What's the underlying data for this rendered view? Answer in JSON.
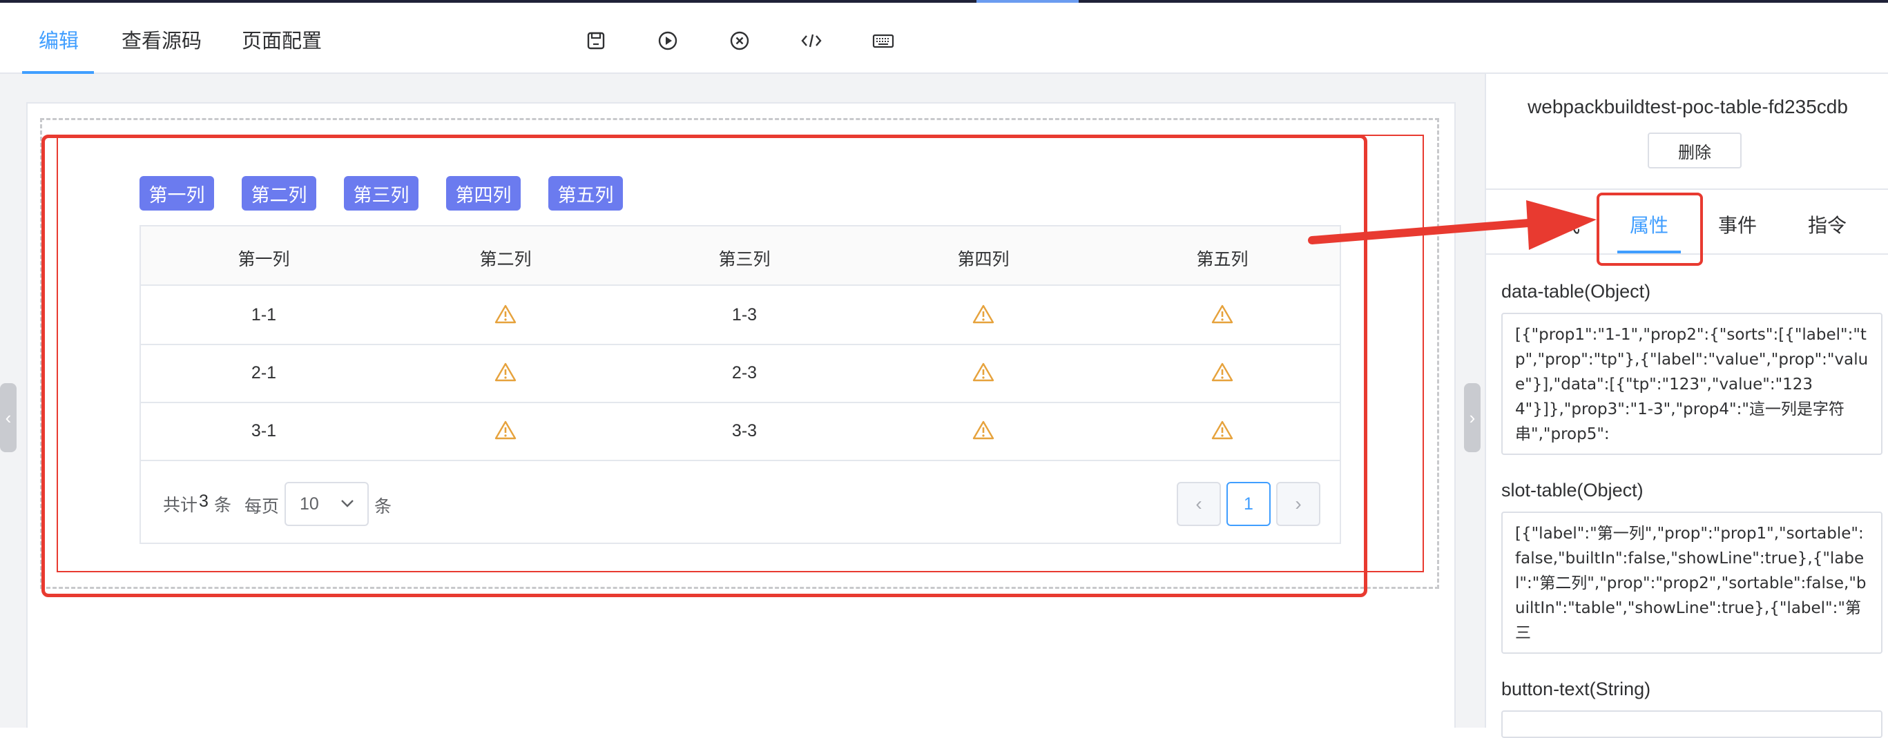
{
  "header": {
    "tabs": [
      {
        "label": "编辑",
        "active": true
      },
      {
        "label": "查看源码",
        "active": false
      },
      {
        "label": "页面配置",
        "active": false
      }
    ],
    "toolbar_icons": [
      "save-icon",
      "play-icon",
      "close-circle-icon",
      "code-icon",
      "keyboard-icon"
    ]
  },
  "canvas": {
    "column_buttons": [
      "第一列",
      "第二列",
      "第三列",
      "第四列",
      "第五列"
    ],
    "table": {
      "headers": [
        "第一列",
        "第二列",
        "第三列",
        "第四列",
        "第五列"
      ],
      "rows": [
        [
          "1-1",
          "warning-icon",
          "1-3",
          "warning-icon",
          "warning-icon"
        ],
        [
          "2-1",
          "warning-icon",
          "2-3",
          "warning-icon",
          "warning-icon"
        ],
        [
          "3-1",
          "warning-icon",
          "3-3",
          "warning-icon",
          "warning-icon"
        ]
      ]
    },
    "pagination": {
      "total_prefix": "共计",
      "total_count": "3",
      "total_suffix": "条",
      "per_page_label": "每页",
      "page_size": "10",
      "per_page_unit": "条",
      "current_page": "1"
    }
  },
  "panel": {
    "component_name": "webpackbuildtest-poc-table-fd235cdb",
    "delete_label": "删除",
    "tabs": [
      {
        "label": "样式",
        "active": false
      },
      {
        "label": "属性",
        "active": true
      },
      {
        "label": "事件",
        "active": false
      },
      {
        "label": "指令",
        "active": false
      }
    ],
    "props": [
      {
        "label": "data-table(Object)",
        "value": "[{\"prop1\":\"1-1\",\"prop2\":{\"sorts\":[{\"label\":\"tp\",\"prop\":\"tp\"},{\"label\":\"value\",\"prop\":\"value\"}],\"data\":[{\"tp\":\"123\",\"value\":\"1234\"}]},\"prop3\":\"1-3\",\"prop4\":\"這一列是字符串\",\"prop5\":"
      },
      {
        "label": "slot-table(Object)",
        "value": "[{\"label\":\"第一列\",\"prop\":\"prop1\",\"sortable\":false,\"builtIn\":false,\"showLine\":true},{\"label\":\"第二列\",\"prop\":\"prop2\",\"sortable\":false,\"builtIn\":\"table\",\"showLine\":true},{\"label\":\"第三"
      },
      {
        "label": "button-text(String)",
        "value": ""
      }
    ]
  },
  "colors": {
    "accent": "#409eff",
    "column_button": "#6b7bef",
    "annotation_red": "#e83a30",
    "warning": "#e6a23c"
  }
}
